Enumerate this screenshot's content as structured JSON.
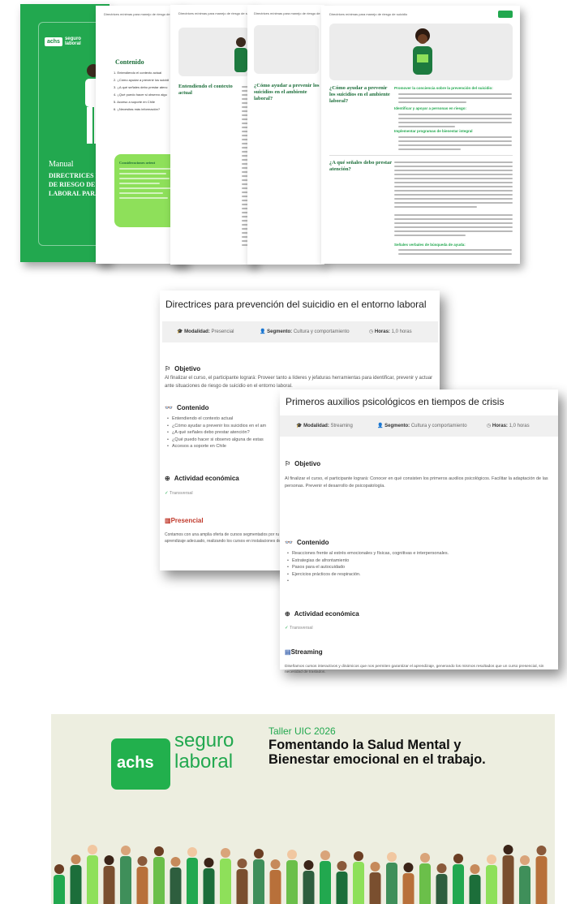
{
  "manual": {
    "cover": {
      "logo_mark": "achs",
      "logo_text": "seguro laboral",
      "label": "Manual",
      "title": "DIRECTRICES P\nDE RIESGO DE S\nLABORAL PARA"
    },
    "header_text": "Directrices mínimas para manejo de riesgo de suicidio",
    "toc_title": "Contenido",
    "toc_items": [
      "1. Entendiendo el contexto actual",
      "2. ¿Cómo ayudar a prevenir los suicidi",
      "3. ¿A qué señales debo prestar atenc",
      "4. ¿Qué puedo hacer si observo algu",
      "5. Acceso a soporte en Chile",
      "6. ¿Necesitas más información?"
    ],
    "considerations_title": "Consideraciones orient",
    "page3_heading": "Entendiendo el contexto actual",
    "page4_heading": "¿Cómo ayudar a prevenir los suicidios en el ambiente laboral?",
    "page5_heading_1": "¿Cómo ayudar a prevenir los suicidios en el ambiente laboral?",
    "page5_heading_2": "¿A qué señales debo prestar atención?",
    "page5_bullets": [
      "Promover la conciencia sobre la prevención del suicidio:",
      "Identificar y apoyar a personas en riesgo:",
      "Implementar programas de bienestar integral",
      "Señales verbales de búsqueda de ayuda:"
    ]
  },
  "course1": {
    "title": "Directrices para prevención del suicidio en el entorno laboral",
    "modalidad_label": "Modalidad:",
    "modalidad_value": "Presencial",
    "segmento_label": "Segmento:",
    "segmento_value": "Cultura y comportamiento",
    "horas_label": "Horas:",
    "horas_value": "1,0 horas",
    "objetivo_title": "Objetivo",
    "objetivo_text": "Al finalizar el curso, el participante logrará: Proveer tanto a líderes y jefaturas herramientas para identificar, prevenir y actuar ante situaciones de riesgo de suicidio en el entorno laboral.",
    "contenido_title": "Contenido",
    "contenido_items": [
      "Entendiendo el contexto actual",
      "¿Cómo ayudar a prevenir los suicidios en el am",
      "¿A qué señales debo prestar atención?",
      "¿Qué puedo hacer si observo alguna de estas",
      "Accesos a soporte en Chile"
    ],
    "actividad_title": "Actividad económica",
    "actividad_value": "Transversal",
    "modalidad_section_title": "Presencial",
    "modalidad_section_text": "Contamos con una amplia oferta de cursos segmentados por ru aprendizaje adecuado, realizando los cursos en instalaciones de"
  },
  "course2": {
    "title": "Primeros auxilios psicológicos en tiempos de crisis",
    "modalidad_label": "Modalidad:",
    "modalidad_value": "Streaming",
    "segmento_label": "Segmento:",
    "segmento_value": "Cultura y comportamiento",
    "horas_label": "Horas:",
    "horas_value": "1,0 horas",
    "objetivo_title": "Objetivo",
    "objetivo_text": "Al finalizar el curso, el participante logrará: Conocer en qué consisten los primeros auxilios psicológicos. Facilitar la adaptación de las personas. Prevenir el desarrollo de psicopatología.",
    "contenido_title": "Contenido",
    "contenido_items": [
      "Reacciones frente al estrés emocionales y físicas, cognitivas e interpersonales.",
      "Estrategias de afrontamiento",
      "Pasos para el autocuidado",
      "Ejercicios prácticos de respiración.",
      ""
    ],
    "actividad_title": "Actividad económica",
    "actividad_value": "Transversal",
    "modalidad_section_title": "Streaming",
    "modalidad_section_text": "Diseñamos cursos interactivos y dinámicos que nos permiten garantizar el aprendizaje, generando los mismos resultados que un curso presencial, sin necesidad de traslados."
  },
  "banner": {
    "logo_mark": "achs",
    "logo_word_1": "seguro",
    "logo_word_2": "laboral",
    "subtitle": "Taller UIC 2026",
    "title": "Fomentando la Salud Mental y Bienestar emocional en el trabajo."
  },
  "colors": {
    "brand_green": "#22a84f",
    "dark_green": "#1c6e3a",
    "light_green": "#8ee05a",
    "banner_bg": "#edeee0"
  }
}
